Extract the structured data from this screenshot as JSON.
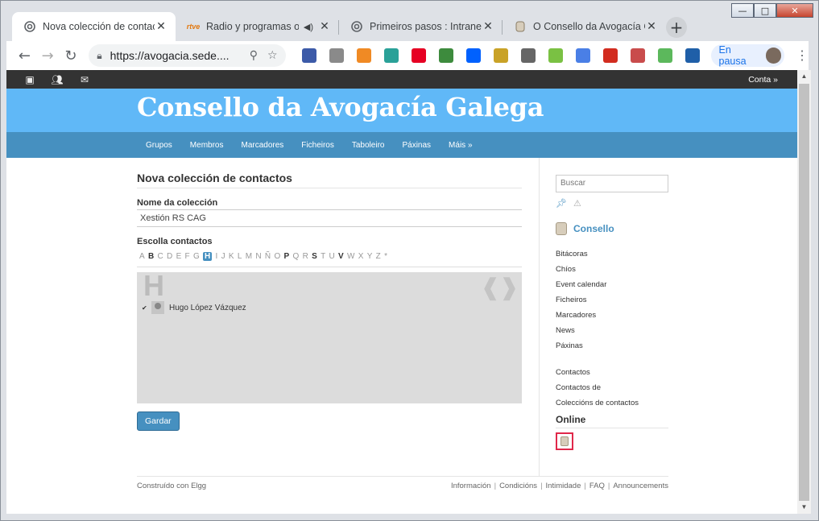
{
  "window": {
    "minimize": "—",
    "maximize": "□",
    "close": "✕"
  },
  "tabs": [
    {
      "title": "Nova colección de contac",
      "icon": "elgg-tab-icon",
      "active": true
    },
    {
      "title": "Radio y programas o",
      "icon": "rtve-tab-icon",
      "icon_text": "rtve",
      "audio": true
    },
    {
      "title": "Primeiros pasos : Intranet",
      "icon": "elgg-tab-icon"
    },
    {
      "title": "O Consello da Avogacía G",
      "icon": "seal-tab-icon"
    }
  ],
  "toolbar": {
    "url": "https://avogacia.sede....",
    "profile_label": "En pausa"
  },
  "extensions": [
    {
      "name": "download-ext-icon",
      "color": "#3c5aa8"
    },
    {
      "name": "bubble-ext-icon",
      "color": "#8a8a8a"
    },
    {
      "name": "osi-ext-icon",
      "color": "#f08a24"
    },
    {
      "name": "crystal-ext-icon",
      "color": "#2aa198"
    },
    {
      "name": "pinterest-ext-icon",
      "color": "#e60023"
    },
    {
      "name": "tool-ext-icon",
      "color": "#3d8b3d"
    },
    {
      "name": "dropbox-ext-icon",
      "color": "#0061fe"
    },
    {
      "name": "notes-ext-icon",
      "color": "#c9a227"
    },
    {
      "name": "camera-ext-icon",
      "color": "#666666"
    },
    {
      "name": "check-ext-icon",
      "color": "#7ac143"
    },
    {
      "name": "translate-ext-icon",
      "color": "#4a7fe6"
    },
    {
      "name": "flash-ext-icon",
      "color": "#d22c1f"
    },
    {
      "name": "card-ext-icon",
      "color": "#c94c4c"
    },
    {
      "name": "android-ext-icon",
      "color": "#5cb85c"
    },
    {
      "name": "movistar-ext-icon",
      "color": "#1f5fa8"
    }
  ],
  "topbar": {
    "account": "Conta »"
  },
  "site": {
    "title": "Consello da Avogacía Galega"
  },
  "nav": [
    "Grupos",
    "Membros",
    "Marcadores",
    "Ficheiros",
    "Taboleiro",
    "Páxinas",
    "Máis »"
  ],
  "form": {
    "heading": "Nova colección de contactos",
    "name_label": "Nome da colección",
    "name_value": "Xestión RS CAG",
    "contacts_label": "Escolla contactos",
    "letters": [
      "A",
      "B",
      "C",
      "D",
      "E",
      "F",
      "G",
      "H",
      "I",
      "J",
      "K",
      "L",
      "M",
      "N",
      "Ñ",
      "O",
      "P",
      "Q",
      "R",
      "S",
      "T",
      "U",
      "V",
      "W",
      "X",
      "Y",
      "Z",
      "*"
    ],
    "letters_with_contacts": [
      "B",
      "H",
      "P",
      "S",
      "V"
    ],
    "current_letter": "H",
    "big_letter": "H",
    "arrows": "❰❱",
    "contact_name": "Hugo López Vázquez",
    "submit": "Gardar"
  },
  "sidebar": {
    "search_placeholder": "Buscar",
    "group_name": "Consello",
    "menu1": [
      "Bitácoras",
      "Chíos",
      "Event calendar",
      "Ficheiros",
      "Marcadores",
      "News",
      "Páxinas"
    ],
    "menu2": [
      "Contactos",
      "Contactos de",
      "Coleccións de contactos"
    ],
    "online_title": "Online"
  },
  "footer": {
    "left": "Construído con Elgg",
    "links": [
      "Información",
      "Condicións",
      "Intimidade",
      "FAQ",
      "Announcements"
    ]
  }
}
